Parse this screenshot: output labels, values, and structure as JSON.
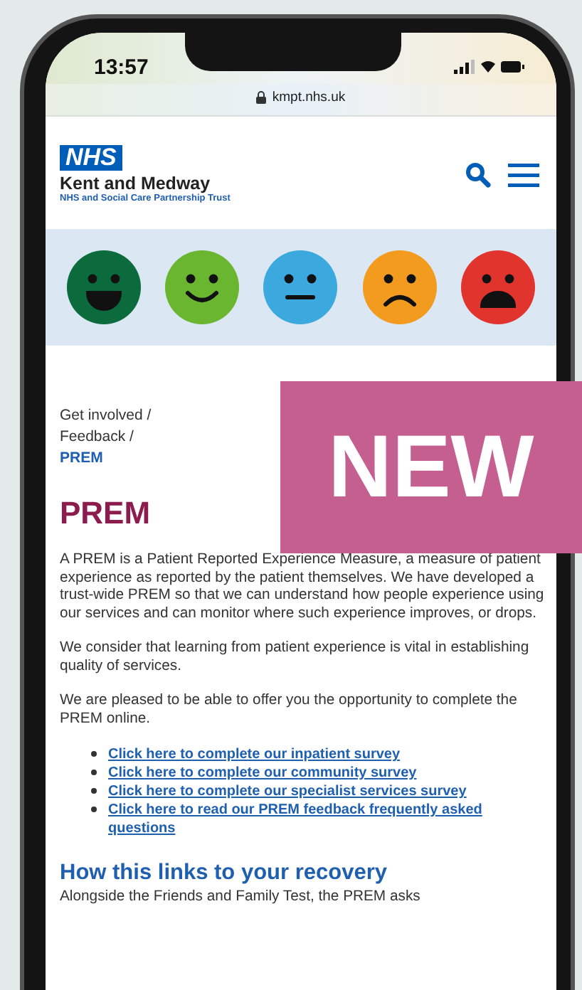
{
  "status_bar": {
    "time": "13:57"
  },
  "address_bar": {
    "url": "kmpt.nhs.uk"
  },
  "header": {
    "logo": "NHS",
    "org_name": "Kent and Medway",
    "org_subtitle": "NHS and Social Care Partnership Trust"
  },
  "mood_faces": [
    {
      "kind": "very_happy",
      "color": "#0b6b3c"
    },
    {
      "kind": "happy",
      "color": "#6ab631"
    },
    {
      "kind": "neutral",
      "color": "#3ba8de"
    },
    {
      "kind": "sad",
      "color": "#f39b1f"
    },
    {
      "kind": "very_sad",
      "color": "#e0342d"
    }
  ],
  "banner": {
    "label": "NEW"
  },
  "breadcrumbs": [
    {
      "label": "Get involved /",
      "current": false
    },
    {
      "label": "Feedback /",
      "current": false
    },
    {
      "label": "PREM",
      "current": true
    }
  ],
  "heading": "PREM",
  "paragraphs": [
    "A PREM is a Patient Reported Experience Measure, a measure of patient experience as reported by the patient themselves. We have developed a trust-wide PREM so that we can understand how people experience using our services and can monitor where such experience improves, or drops.",
    "We consider that learning from patient experience is vital in establishing quality of services.",
    "We are pleased to be able to offer you the opportunity to complete the PREM online."
  ],
  "links": [
    "Click here to complete our inpatient survey",
    "Click here to complete our community survey",
    "Click here to complete our specialist services survey",
    "Click here to read our PREM feedback frequently asked questions"
  ],
  "section_heading": "How this links to your recovery",
  "section_text": "Alongside the Friends and Family Test, the PREM asks"
}
